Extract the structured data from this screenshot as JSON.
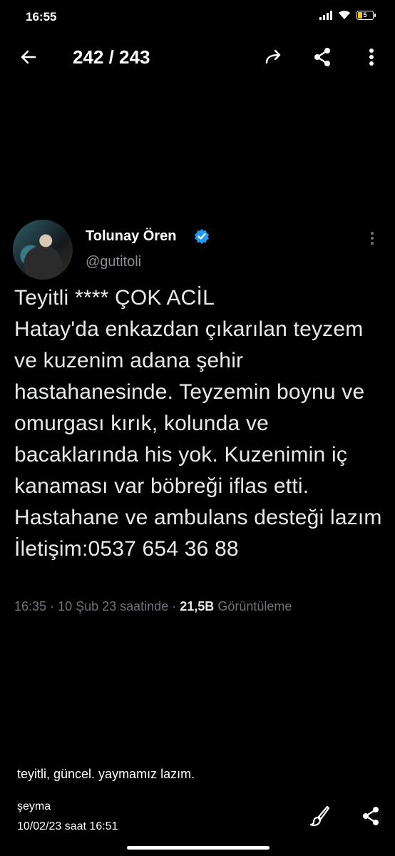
{
  "status_bar": {
    "time": "16:55",
    "battery_level": "5",
    "battery_color": "#f5c11b"
  },
  "top_bar": {
    "counter": "242 / 243",
    "icons": [
      "back-arrow-icon",
      "forward-icon",
      "share-icon",
      "more-vertical-icon"
    ]
  },
  "tweet": {
    "author_name": "Tolunay Ören",
    "handle": "@gutitoli",
    "verified": true,
    "verified_color": "#1d9bf0",
    "text": "Teyitli **** ÇOK ACİL\nHatay'da enkazdan çıkarılan teyzem ve kuzenim adana şehir hastahanesinde. Teyzemin boynu ve omurgası kırık, kolunda ve bacaklarında his yok. Kuzenimin iç kanaması var böbreği iflas etti. Hastahane ve ambulans desteği lazım\nİletişim:0537 654 36 88",
    "time": "16:35",
    "date": "10 Şub 23 saatinde",
    "views_count": "21,5B",
    "views_label": "Görüntüleme",
    "separator": "·"
  },
  "caption": "teyitli, güncel. yaymamız lazım.",
  "sender": {
    "name": "şeyma",
    "timestamp": "10/02/23 saat 16:51"
  },
  "bottom_icons": [
    "edit-brush-icon",
    "share-icon"
  ]
}
